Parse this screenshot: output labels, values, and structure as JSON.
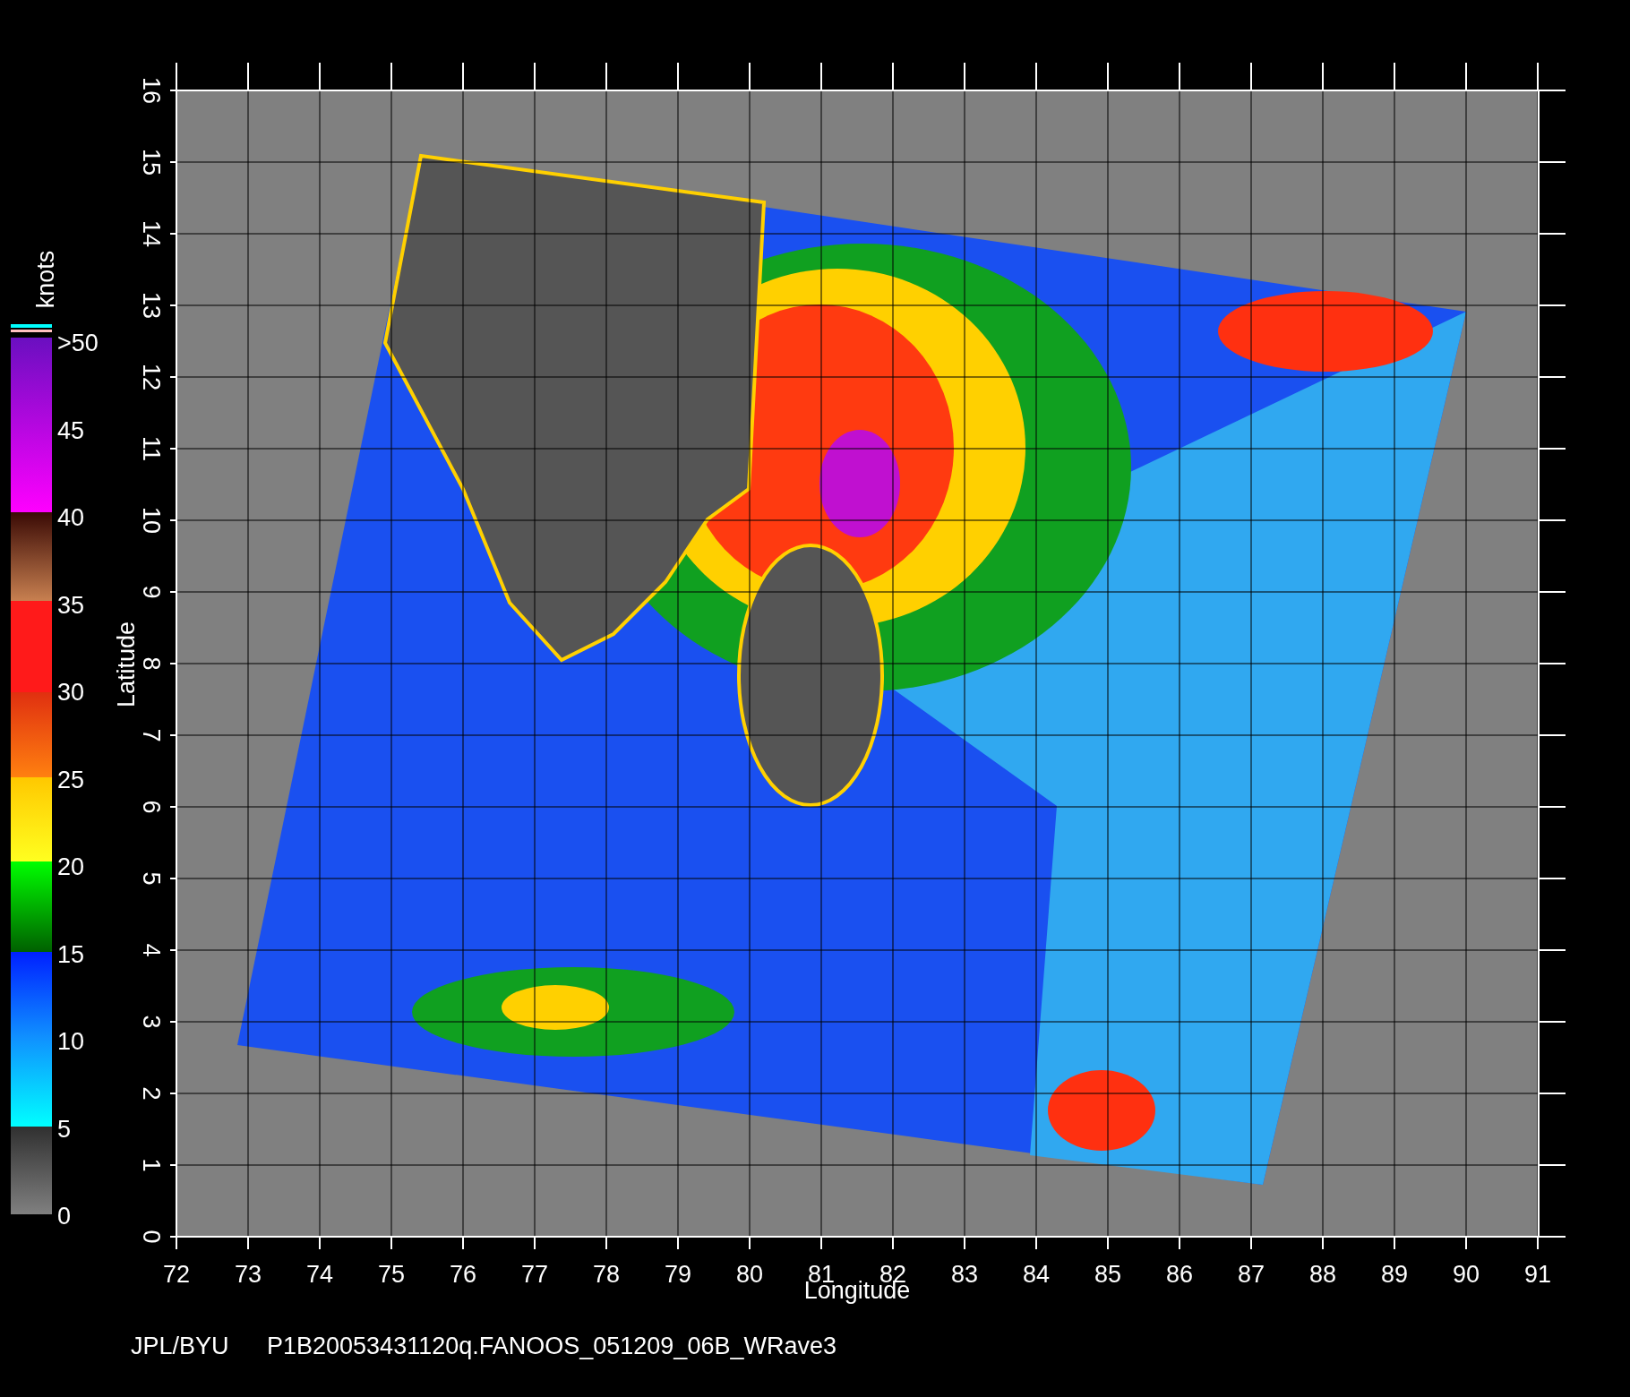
{
  "colorbar": {
    "unit": "knots",
    "labels": [
      ">50",
      "45",
      "40",
      "35",
      "30",
      "25",
      "20",
      "15",
      "10",
      "5",
      "0"
    ]
  },
  "axes": {
    "x_title": "Longitude",
    "y_title": "Latitude",
    "x_ticks": [
      "72",
      "73",
      "74",
      "75",
      "76",
      "77",
      "78",
      "79",
      "80",
      "81",
      "82",
      "83",
      "84",
      "85",
      "86",
      "87",
      "88",
      "89",
      "90",
      "91"
    ],
    "y_ticks": [
      "0",
      "1",
      "2",
      "3",
      "4",
      "5",
      "6",
      "7",
      "8",
      "9",
      "10",
      "11",
      "12",
      "13",
      "14",
      "15",
      "16"
    ]
  },
  "footer": {
    "source": "JPL/BYU",
    "file": "P1B20053431120q.FANOOS_051209_06B_WRave3"
  }
}
